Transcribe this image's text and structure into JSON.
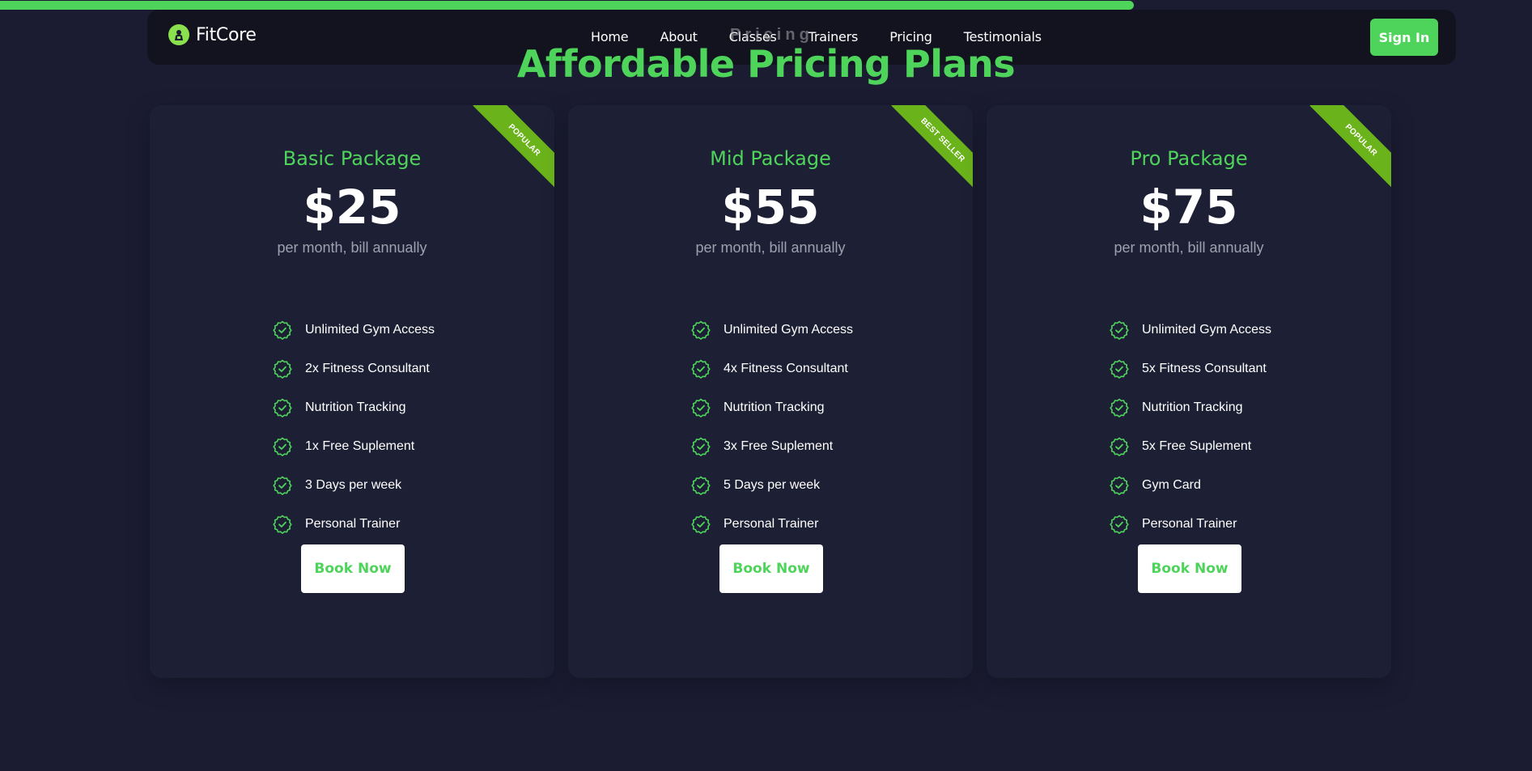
{
  "progress": {
    "value_percent": 74
  },
  "brand": {
    "name": "FitCore",
    "accent": "#4ed45a",
    "icon": "gym-logo-icon"
  },
  "nav": {
    "links": [
      "Home",
      "About",
      "Classes",
      "Trainers",
      "Pricing",
      "Testimonials"
    ],
    "signin_label": "Sign In"
  },
  "section": {
    "kicker": "Pricing",
    "title": "Affordable Pricing Plans"
  },
  "plans": [
    {
      "name": "Basic Package",
      "price": "$25",
      "billing": "per month, bill annually",
      "ribbon": "POPULAR",
      "features": [
        "Unlimited Gym Access",
        "2x Fitness Consultant",
        "Nutrition Tracking",
        "1x Free Suplement",
        "3 Days per week",
        "Personal Trainer"
      ],
      "cta": "Book Now"
    },
    {
      "name": "Mid Package",
      "price": "$55",
      "billing": "per month, bill annually",
      "ribbon": "BEST SELLER",
      "features": [
        "Unlimited Gym Access",
        "4x Fitness Consultant",
        "Nutrition Tracking",
        "3x Free Suplement",
        "5 Days per week",
        "Personal Trainer"
      ],
      "cta": "Book Now"
    },
    {
      "name": "Pro Package",
      "price": "$75",
      "billing": "per month, bill annually",
      "ribbon": "POPULAR",
      "features": [
        "Unlimited Gym Access",
        "5x Fitness Consultant",
        "Nutrition Tracking",
        "5x Free Suplement",
        "Gym Card",
        "Personal Trainer"
      ],
      "cta": "Book Now"
    }
  ],
  "colors": {
    "background": "#1b1c32",
    "card": "#1d1f35",
    "navbar": "#12131f",
    "ribbon": "#6bb31b"
  }
}
